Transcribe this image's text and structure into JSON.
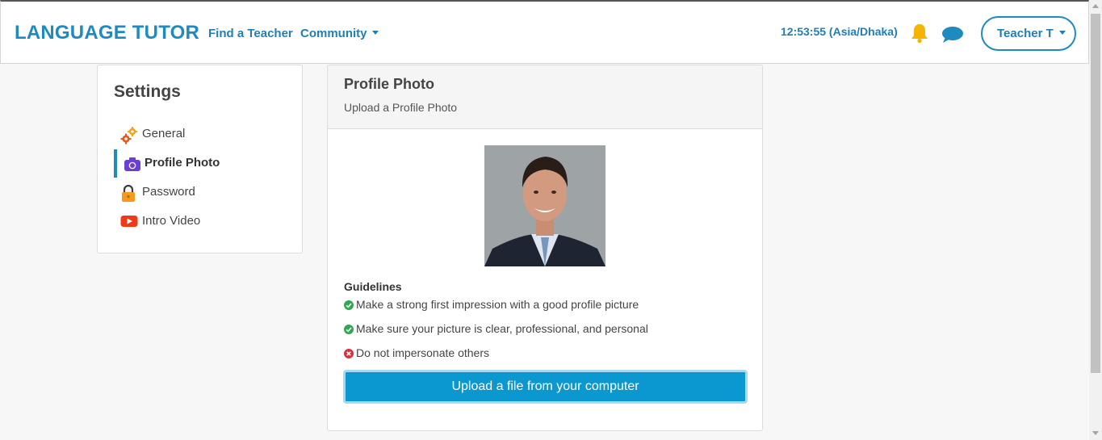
{
  "nav": {
    "brand": "LANGUAGE TUTOR",
    "find_teacher": "Find a Teacher",
    "community": "Community",
    "clock": "12:53:55 (Asia/Dhaka)",
    "user": "Teacher T",
    "icons": {
      "notifications": "bell-icon",
      "messages": "chat-bubble-icon"
    }
  },
  "sidebar": {
    "title": "Settings",
    "items": [
      {
        "label": "General",
        "icon": "gears-icon",
        "active": false
      },
      {
        "label": "Profile Photo",
        "icon": "camera-icon",
        "active": true
      },
      {
        "label": "Password",
        "icon": "padlock-icon",
        "active": false
      },
      {
        "label": "Intro Video",
        "icon": "video-play-icon",
        "active": false
      }
    ]
  },
  "card": {
    "title": "Profile Photo",
    "subtitle": "Upload a Profile Photo",
    "guidelines_title": "Guidelines",
    "guidelines": [
      {
        "text": "Make a strong first impression with a good profile picture",
        "status": "ok"
      },
      {
        "text": "Make sure your picture is clear, professional, and personal",
        "status": "ok"
      },
      {
        "text": "Do not impersonate others",
        "status": "no"
      }
    ],
    "upload_label": "Upload a file from your computer"
  },
  "colors": {
    "brand": "#1f8ac0",
    "button": "#0b97cf",
    "ok": "#2fa84f",
    "no": "#d9323f",
    "bell": "#f4b400"
  }
}
